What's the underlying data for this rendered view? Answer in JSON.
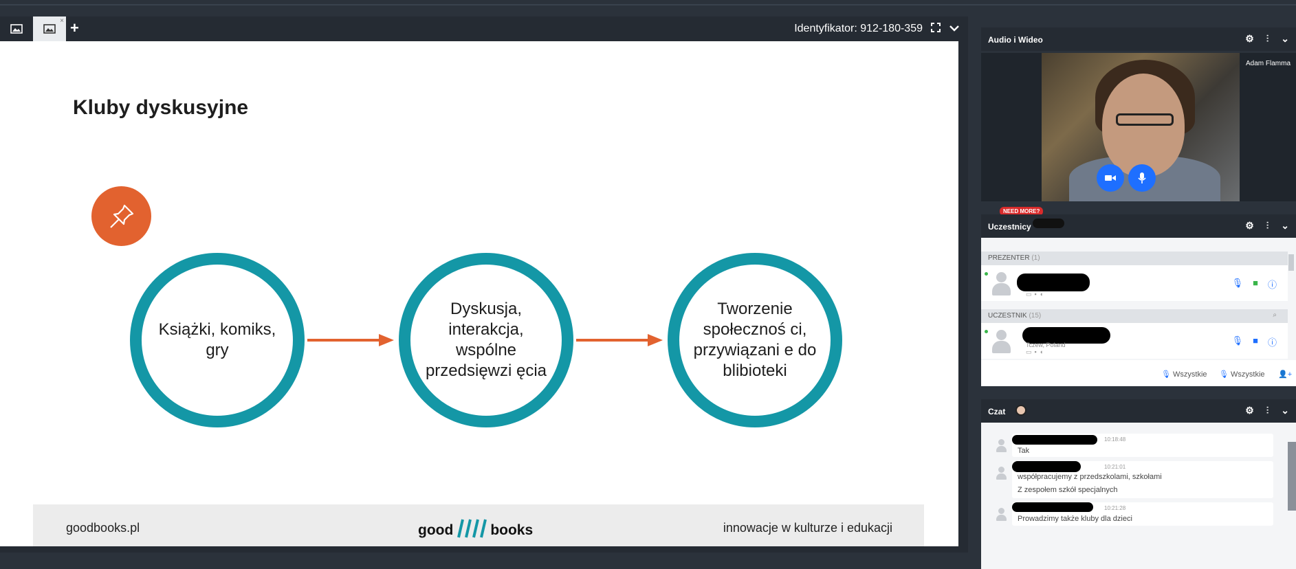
{
  "presentation": {
    "tabs": [
      {
        "icon": "image-icon",
        "active": false
      },
      {
        "icon": "image-icon",
        "active": true,
        "close": "×"
      }
    ],
    "add_tab": "+",
    "meeting_id_label": "Identyfikator: 912-180-359",
    "expand_icon": "expand-icon",
    "collapse_icon": "chevron-down-icon"
  },
  "slide": {
    "title": "Kluby dyskusyjne",
    "steps": [
      "Książki, komiks, gry",
      "Dyskusja, interakcja, wspólne przedsięwzi ęcia",
      "Tworzenie społecznoś ci, przywiązani e do blibioteki"
    ],
    "colors": {
      "accent": "#e2622f",
      "ring": "#1497a6"
    },
    "footer": {
      "left": "goodbooks.pl",
      "logo_left": "good",
      "logo_right": "books",
      "right": "innowacje w kulturze i edukacji"
    }
  },
  "audio_video": {
    "title": "Audio i Wideo",
    "participant_name": "Adam Flamma"
  },
  "participants": {
    "title": "Uczestnicy",
    "badge": "NEED MORE?",
    "presenter_group": "PREZENTER",
    "presenter_count": "(1)",
    "attendee_group": "UCZESTNIK",
    "attendee_count": "(15)",
    "attendee_location": "Tczew, Poland",
    "footer_all_mic": "Wszystkie",
    "footer_all_cam": "Wszystkie"
  },
  "chat": {
    "title": "Czat",
    "messages": [
      {
        "time": "10:18:48",
        "lines": [
          "Tak"
        ]
      },
      {
        "time": "10:21:01",
        "lines": [
          "współpracujemy z przedszkolami, szkołami",
          "Z zespołem szkół specjalnych"
        ]
      },
      {
        "time": "10:21:28",
        "lines": [
          "Prowadzimy także kluby dla dzieci"
        ]
      }
    ]
  }
}
